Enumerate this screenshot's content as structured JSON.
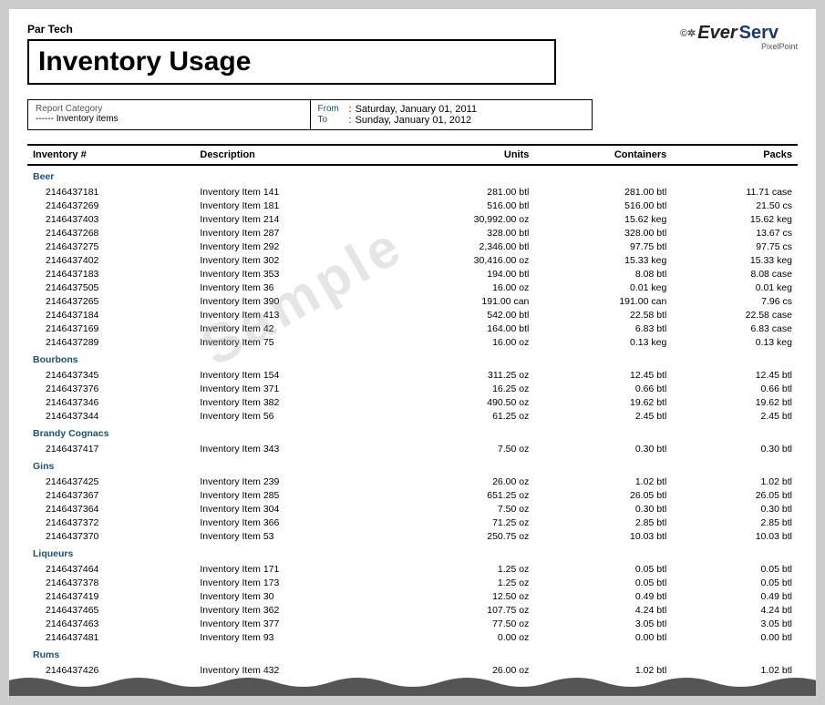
{
  "company": {
    "name": "Par Tech"
  },
  "report": {
    "title": "Inventory Usage",
    "meta": {
      "category_label": "Report Category",
      "category_value": "------ Inventory items",
      "from_label": "From",
      "from_colon": ":",
      "from_value": "Saturday, January 01, 2011",
      "to_label": "To",
      "to_colon": ":",
      "to_value": "Sunday, January 01, 2012"
    }
  },
  "table": {
    "headers": [
      "Inventory #",
      "Description",
      "Units",
      "Containers",
      "Packs"
    ],
    "categories": [
      {
        "name": "Beer",
        "rows": [
          {
            "inv": "2146437181",
            "desc": "Inventory Item 141",
            "units": "281.00 btl",
            "containers": "281.00  btl",
            "packs": "11.71 case"
          },
          {
            "inv": "2146437269",
            "desc": "Inventory Item 181",
            "units": "516.00 btl",
            "containers": "516.00  btl",
            "packs": "21.50  cs"
          },
          {
            "inv": "2146437403",
            "desc": "Inventory Item 214",
            "units": "30,992.00 oz",
            "containers": "15.62  keg",
            "packs": "15.62  keg"
          },
          {
            "inv": "2146437268",
            "desc": "Inventory Item 287",
            "units": "328.00 btl",
            "containers": "328.00  btl",
            "packs": "13.67  cs"
          },
          {
            "inv": "2146437275",
            "desc": "Inventory Item 292",
            "units": "2,346.00 btl",
            "containers": "97.75  btl",
            "packs": "97.75  cs"
          },
          {
            "inv": "2146437402",
            "desc": "Inventory Item 302",
            "units": "30,416.00 oz",
            "containers": "15.33  keg",
            "packs": "15.33  keg"
          },
          {
            "inv": "2146437183",
            "desc": "Inventory Item 353",
            "units": "194.00 btl",
            "containers": "8.08  btl",
            "packs": "8.08 case"
          },
          {
            "inv": "2146437505",
            "desc": "Inventory Item 36",
            "units": "16.00 oz",
            "containers": "0.01  keg",
            "packs": "0.01  keg"
          },
          {
            "inv": "2146437265",
            "desc": "Inventory Item 390",
            "units": "191.00 can",
            "containers": "191.00  can",
            "packs": "7.96  cs"
          },
          {
            "inv": "2146437184",
            "desc": "Inventory Item 413",
            "units": "542.00 btl",
            "containers": "22.58  btl",
            "packs": "22.58 case"
          },
          {
            "inv": "2146437169",
            "desc": "Inventory Item 42",
            "units": "164.00 btl",
            "containers": "6.83  btl",
            "packs": "6.83 case"
          },
          {
            "inv": "2146437289",
            "desc": "Inventory Item 75",
            "units": "16.00 oz",
            "containers": "0.13  keg",
            "packs": "0.13  keg"
          }
        ]
      },
      {
        "name": "Bourbons",
        "rows": [
          {
            "inv": "2146437345",
            "desc": "Inventory Item 154",
            "units": "311.25 oz",
            "containers": "12.45  btl",
            "packs": "12.45  btl"
          },
          {
            "inv": "2146437376",
            "desc": "Inventory Item 371",
            "units": "16.25 oz",
            "containers": "0.66  btl",
            "packs": "0.66  btl"
          },
          {
            "inv": "2146437346",
            "desc": "Inventory Item 382",
            "units": "490.50 oz",
            "containers": "19.62  btl",
            "packs": "19.62  btl"
          },
          {
            "inv": "2146437344",
            "desc": "Inventory Item 56",
            "units": "61.25 oz",
            "containers": "2.45  btl",
            "packs": "2.45  btl"
          }
        ]
      },
      {
        "name": "Brandy Cognacs",
        "rows": [
          {
            "inv": "2146437417",
            "desc": "Inventory Item 343",
            "units": "7.50 oz",
            "containers": "0.30  btl",
            "packs": "0.30  btl"
          }
        ]
      },
      {
        "name": "Gins",
        "rows": [
          {
            "inv": "2146437425",
            "desc": "Inventory Item 239",
            "units": "26.00 oz",
            "containers": "1.02  btl",
            "packs": "1.02  btl"
          },
          {
            "inv": "2146437367",
            "desc": "Inventory Item 285",
            "units": "651.25 oz",
            "containers": "26.05  btl",
            "packs": "26.05  btl"
          },
          {
            "inv": "2146437364",
            "desc": "Inventory Item 304",
            "units": "7.50 oz",
            "containers": "0.30  btl",
            "packs": "0.30  btl"
          },
          {
            "inv": "2146437372",
            "desc": "Inventory Item 366",
            "units": "71.25 oz",
            "containers": "2.85  btl",
            "packs": "2.85  btl"
          },
          {
            "inv": "2146437370",
            "desc": "Inventory Item 53",
            "units": "250.75 oz",
            "containers": "10.03  btl",
            "packs": "10.03  btl"
          }
        ]
      },
      {
        "name": "Liqueurs",
        "rows": [
          {
            "inv": "2146437464",
            "desc": "Inventory Item 171",
            "units": "1.25 oz",
            "containers": "0.05  btl",
            "packs": "0.05  btl"
          },
          {
            "inv": "2146437378",
            "desc": "Inventory Item 173",
            "units": "1.25 oz",
            "containers": "0.05  btl",
            "packs": "0.05  btl"
          },
          {
            "inv": "2146437419",
            "desc": "Inventory Item 30",
            "units": "12.50 oz",
            "containers": "0.49  btl",
            "packs": "0.49  btl"
          },
          {
            "inv": "2146437465",
            "desc": "Inventory Item 362",
            "units": "107.75 oz",
            "containers": "4.24  btl",
            "packs": "4.24  btl"
          },
          {
            "inv": "2146437463",
            "desc": "Inventory Item 377",
            "units": "77.50 oz",
            "containers": "3.05  btl",
            "packs": "3.05  btl"
          },
          {
            "inv": "2146437481",
            "desc": "Inventory Item 93",
            "units": "0.00 oz",
            "containers": "0.00  btl",
            "packs": "0.00  btl"
          }
        ]
      },
      {
        "name": "Rums",
        "rows": [
          {
            "inv": "2146437426",
            "desc": "Inventory Item 432",
            "units": "26.00 oz",
            "containers": "1.02  btl",
            "packs": "1.02  btl"
          }
        ]
      }
    ]
  },
  "watermark": "Sample",
  "logo": {
    "symbol": "©✲",
    "ever": "Ever",
    "serv": "Serv",
    "tagline": "PixelPoint"
  }
}
